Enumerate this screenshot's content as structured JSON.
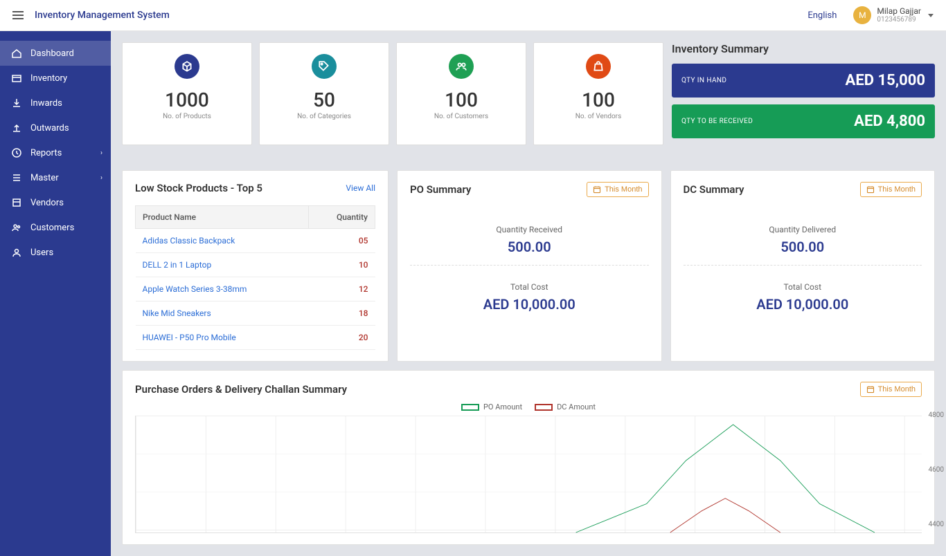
{
  "header": {
    "app_title": "Inventory Management System",
    "language": "English",
    "avatar_initial": "M",
    "user_name": "Milap Gajjar",
    "user_id": "0123456789"
  },
  "sidebar": {
    "items": [
      {
        "label": "Dashboard",
        "icon": "home",
        "active": true,
        "chevron": false
      },
      {
        "label": "Inventory",
        "icon": "box",
        "active": false,
        "chevron": false
      },
      {
        "label": "Inwards",
        "icon": "download",
        "active": false,
        "chevron": false
      },
      {
        "label": "Outwards",
        "icon": "upload",
        "active": false,
        "chevron": false
      },
      {
        "label": "Reports",
        "icon": "clock",
        "active": false,
        "chevron": true
      },
      {
        "label": "Master",
        "icon": "list",
        "active": false,
        "chevron": true
      },
      {
        "label": "Vendors",
        "icon": "package",
        "active": false,
        "chevron": false
      },
      {
        "label": "Customers",
        "icon": "users",
        "active": false,
        "chevron": false
      },
      {
        "label": "Users",
        "icon": "user",
        "active": false,
        "chevron": false
      }
    ]
  },
  "stats": [
    {
      "value": "1000",
      "label": "No. of Products",
      "color": "blue",
      "icon": "cube"
    },
    {
      "value": "50",
      "label": "No. of Categories",
      "color": "teal",
      "icon": "tag"
    },
    {
      "value": "100",
      "label": "No. of Customers",
      "color": "green",
      "icon": "users"
    },
    {
      "value": "100",
      "label": "No. of Vendors",
      "color": "orange",
      "icon": "bag"
    }
  ],
  "inventory_summary": {
    "title": "Inventory Summary",
    "qty_in_hand": {
      "label": "QTY IN HAND",
      "value": "AED 15,000"
    },
    "qty_to_receive": {
      "label": "QTY TO BE RECEIVED",
      "value": "AED 4,800"
    }
  },
  "low_stock": {
    "title": "Low Stock Products - Top 5",
    "view_all": "View All",
    "headers": {
      "name": "Product Name",
      "qty": "Quantity"
    },
    "rows": [
      {
        "name": "Adidas Classic Backpack",
        "qty": "05"
      },
      {
        "name": "DELL 2 in 1 Laptop",
        "qty": "10"
      },
      {
        "name": "Apple Watch Series 3-38mm",
        "qty": "12"
      },
      {
        "name": "Nike Mid Sneakers",
        "qty": "18"
      },
      {
        "name": "HUAWEI - P50 Pro Mobile",
        "qty": "20"
      }
    ]
  },
  "po_summary": {
    "title": "PO Summary",
    "filter": "This Month",
    "qty_label": "Quantity Received",
    "qty_value": "500.00",
    "cost_label": "Total Cost",
    "cost_value": "AED 10,000.00"
  },
  "dc_summary": {
    "title": "DC Summary",
    "filter": "This Month",
    "qty_label": "Quantity Delivered",
    "qty_value": "500.00",
    "cost_label": "Total Cost",
    "cost_value": "AED 10,000.00"
  },
  "chart_section": {
    "title": "Purchase Orders & Delivery Challan Summary",
    "filter": "This Month",
    "legend": [
      {
        "name": "PO Amount",
        "color": "#169c56"
      },
      {
        "name": "DC Amount",
        "color": "#b0342c"
      }
    ]
  },
  "chart_data": {
    "type": "line",
    "y_ticks": [
      4800,
      4600,
      4400
    ],
    "ylim": [
      4200,
      4850
    ],
    "series": [
      {
        "name": "PO Amount",
        "color": "#169c56",
        "points": [
          [
            0.56,
            4200
          ],
          [
            0.65,
            4360
          ],
          [
            0.7,
            4600
          ],
          [
            0.76,
            4800
          ],
          [
            0.82,
            4600
          ],
          [
            0.87,
            4360
          ],
          [
            0.94,
            4200
          ]
        ]
      },
      {
        "name": "DC Amount",
        "color": "#b0342c",
        "points": [
          [
            0.68,
            4200
          ],
          [
            0.72,
            4320
          ],
          [
            0.75,
            4390
          ],
          [
            0.78,
            4320
          ],
          [
            0.82,
            4200
          ]
        ]
      }
    ]
  }
}
